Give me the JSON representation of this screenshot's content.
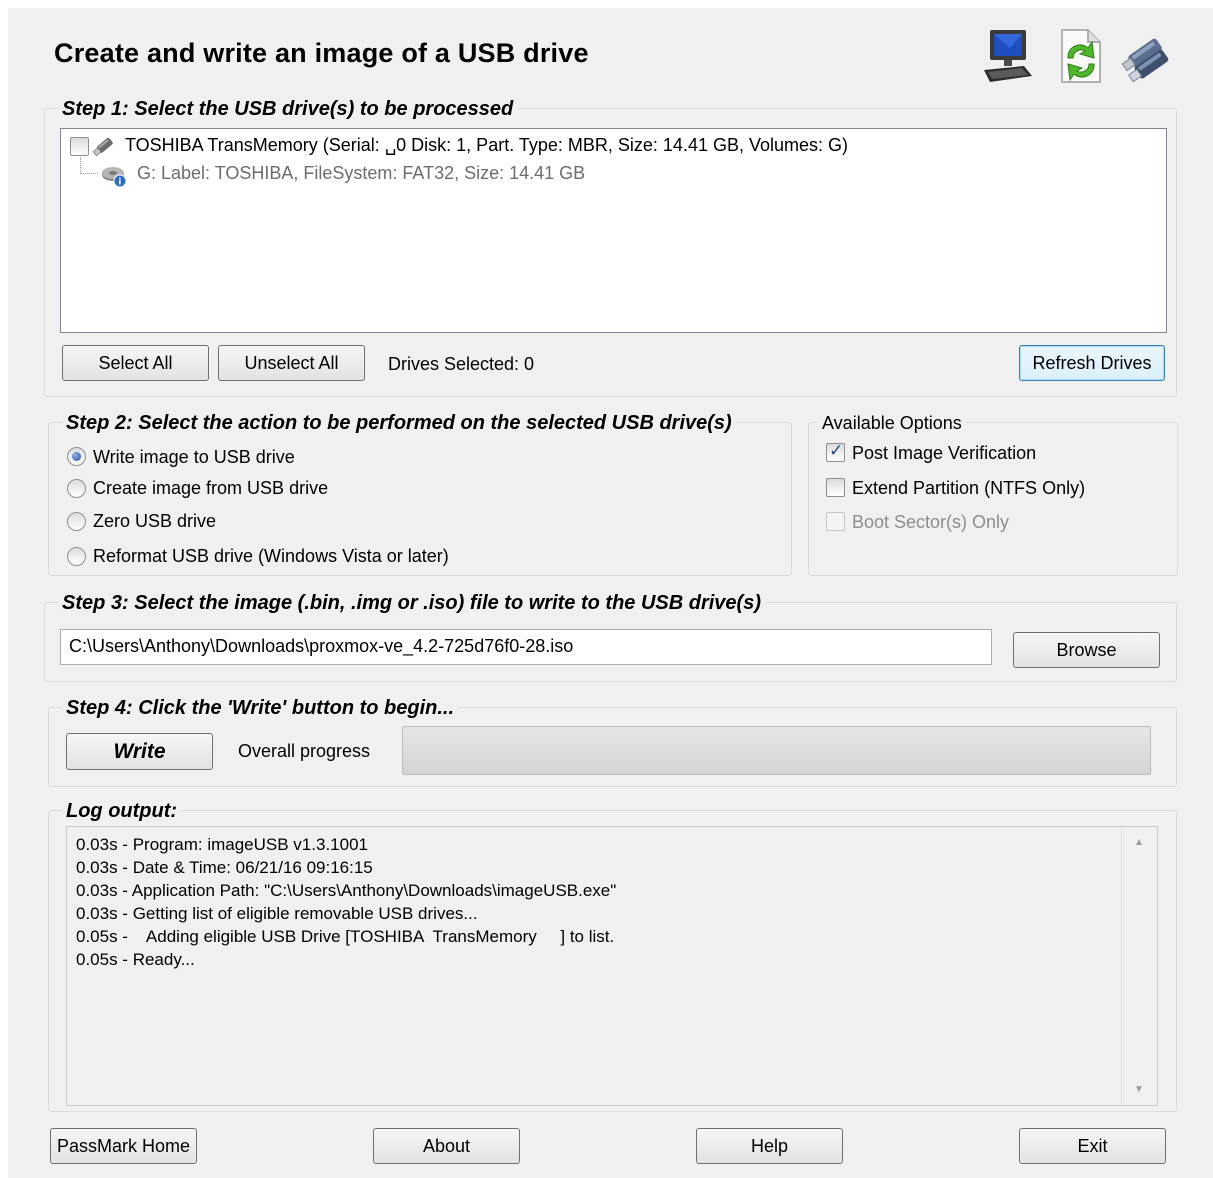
{
  "header": {
    "title": "Create and write an image of a USB drive",
    "icons": [
      "computer-icon",
      "refresh-document-icon",
      "usb-drives-icon"
    ]
  },
  "step1": {
    "label": "Step 1:  Select the USB drive(s) to be processed",
    "drive": {
      "checked": false,
      "text": "TOSHIBA TransMemory (Serial: ␣0 Disk: 1, Part. Type: MBR, Size: 14.41 GB, Volumes: G)",
      "volume": "G: Label: TOSHIBA, FileSystem: FAT32, Size: 14.41 GB"
    },
    "select_all": "Select All",
    "unselect_all": "Unselect All",
    "drives_selected": "Drives Selected: 0",
    "refresh": "Refresh Drives"
  },
  "step2": {
    "label": "Step 2: Select the action to be performed on the selected USB drive(s)",
    "actions": [
      {
        "label": "Write image to USB drive",
        "selected": true
      },
      {
        "label": "Create image from USB drive",
        "selected": false
      },
      {
        "label": "Zero USB drive",
        "selected": false
      },
      {
        "label": "Reformat USB drive (Windows Vista or later)",
        "selected": false
      }
    ]
  },
  "options": {
    "label": "Available Options",
    "items": [
      {
        "label": "Post Image Verification",
        "checked": true,
        "enabled": true
      },
      {
        "label": "Extend Partition (NTFS Only)",
        "checked": false,
        "enabled": true
      },
      {
        "label": "Boot Sector(s) Only",
        "checked": false,
        "enabled": false
      }
    ]
  },
  "step3": {
    "label": "Step 3: Select the image (.bin, .img or .iso) file to write to the USB drive(s)",
    "path": "C:\\Users\\Anthony\\Downloads\\proxmox-ve_4.2-725d76f0-28.iso",
    "browse": "Browse"
  },
  "step4": {
    "label": "Step 4: Click the 'Write' button to begin...",
    "write": "Write",
    "progress_label": "Overall progress",
    "progress_percent": 0
  },
  "log": {
    "label": "Log output:",
    "lines": [
      "0.03s - Program: imageUSB v1.3.1001",
      "0.03s - Date & Time: 06/21/16 09:16:15",
      "0.03s - Application Path: \"C:\\Users\\Anthony\\Downloads\\imageUSB.exe\"",
      "0.03s - Getting list of eligible removable USB drives...",
      "0.05s -    Adding eligible USB Drive [TOSHIBA  TransMemory     ] to list.",
      "0.05s - Ready..."
    ]
  },
  "footer": {
    "passmark": "PassMark Home",
    "about": "About",
    "help": "Help",
    "exit": "Exit"
  }
}
